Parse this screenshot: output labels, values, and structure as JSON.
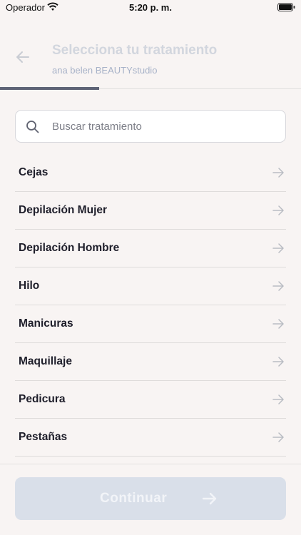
{
  "status_bar": {
    "carrier": "Operador",
    "time": "5:20 p. m."
  },
  "header": {
    "title": "Selecciona tu tratamiento",
    "subtitle": "ana belen BEAUTYstudio"
  },
  "progress": {
    "fraction": 0.33
  },
  "search": {
    "placeholder": "Buscar tratamiento",
    "value": ""
  },
  "treatments": [
    {
      "label": "Cejas"
    },
    {
      "label": "Depilación Mujer"
    },
    {
      "label": "Depilación Hombre"
    },
    {
      "label": "Hilo"
    },
    {
      "label": "Manicuras"
    },
    {
      "label": "Maquillaje"
    },
    {
      "label": "Pedicura"
    },
    {
      "label": "Pestañas"
    }
  ],
  "footer": {
    "continue_label": "Continuar"
  },
  "colors": {
    "background": "#f8f4f3",
    "progress": "#5e6376",
    "button_disabled": "#d9dfe9"
  }
}
